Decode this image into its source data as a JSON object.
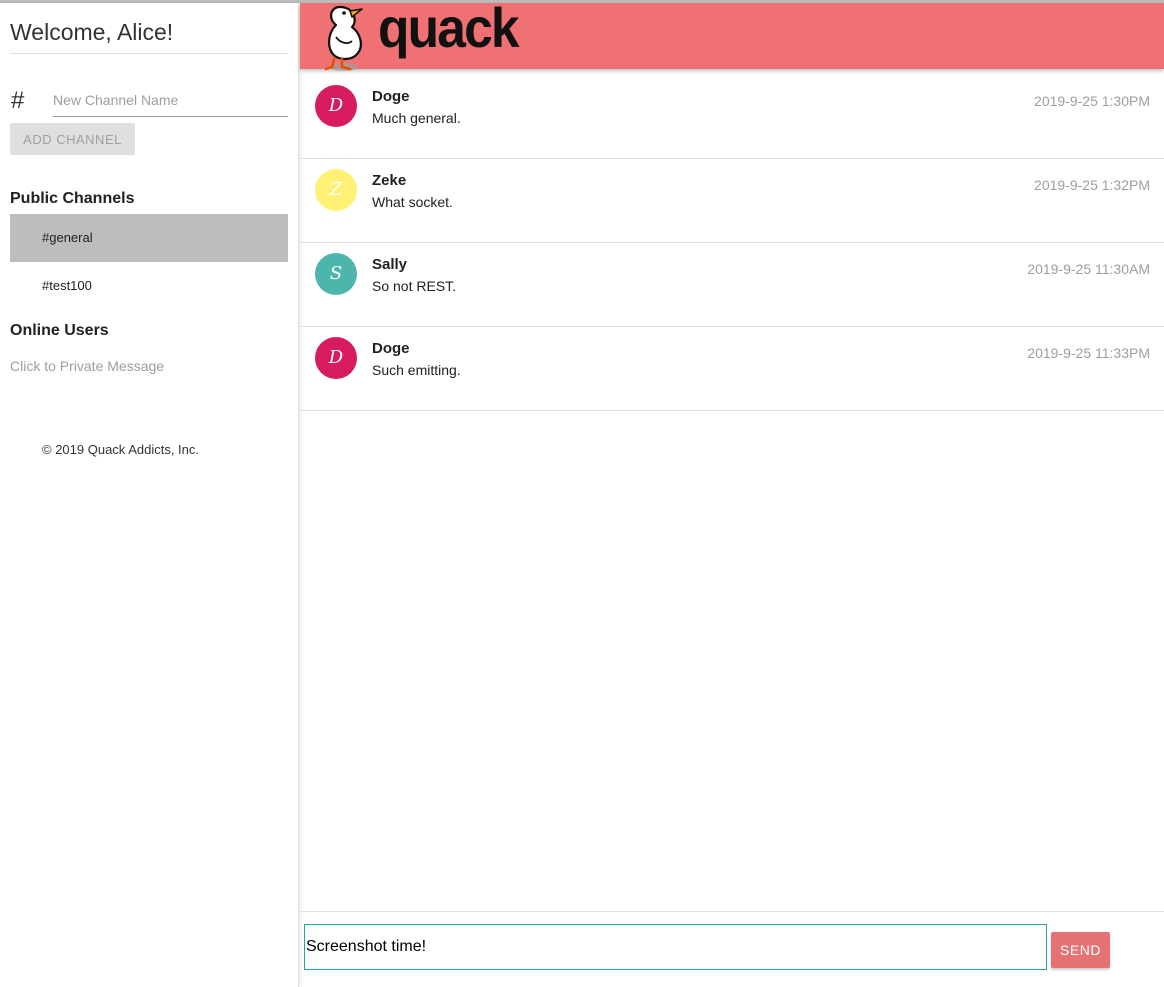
{
  "sidebar": {
    "welcome": "Welcome, Alice!",
    "hash_symbol": "#",
    "channel_input_placeholder": "New Channel Name",
    "channel_input_value": "",
    "add_channel_label": "ADD CHANNEL",
    "public_channels_title": "Public Channels",
    "channels": [
      {
        "label": "#general",
        "active": true
      },
      {
        "label": "#test100",
        "active": false
      }
    ],
    "online_users_title": "Online Users",
    "online_users_hint": "Click to Private Message",
    "copyright": "© 2019 Quack Addicts, Inc."
  },
  "header": {
    "brand": "quack",
    "logo_icon": "duck-icon",
    "background_color": "#f07173"
  },
  "messages": [
    {
      "initial": "D",
      "user": "Doge",
      "text": "Much general.",
      "time": "2019-9-25 1:30PM",
      "avatar_color": "#d81b60"
    },
    {
      "initial": "Z",
      "user": "Zeke",
      "text": "What socket.",
      "time": "2019-9-25 1:32PM",
      "avatar_color": "#fff176"
    },
    {
      "initial": "S",
      "user": "Sally",
      "text": "So not REST.",
      "time": "2019-9-25 11:30AM",
      "avatar_color": "#4db6ac"
    },
    {
      "initial": "D",
      "user": "Doge",
      "text": "Such emitting.",
      "time": "2019-9-25 11:33PM",
      "avatar_color": "#d81b60"
    }
  ],
  "composer": {
    "input_value": "Screenshot time!",
    "send_label": "SEND",
    "send_color": "#e57373",
    "focus_color": "#26a69a"
  }
}
